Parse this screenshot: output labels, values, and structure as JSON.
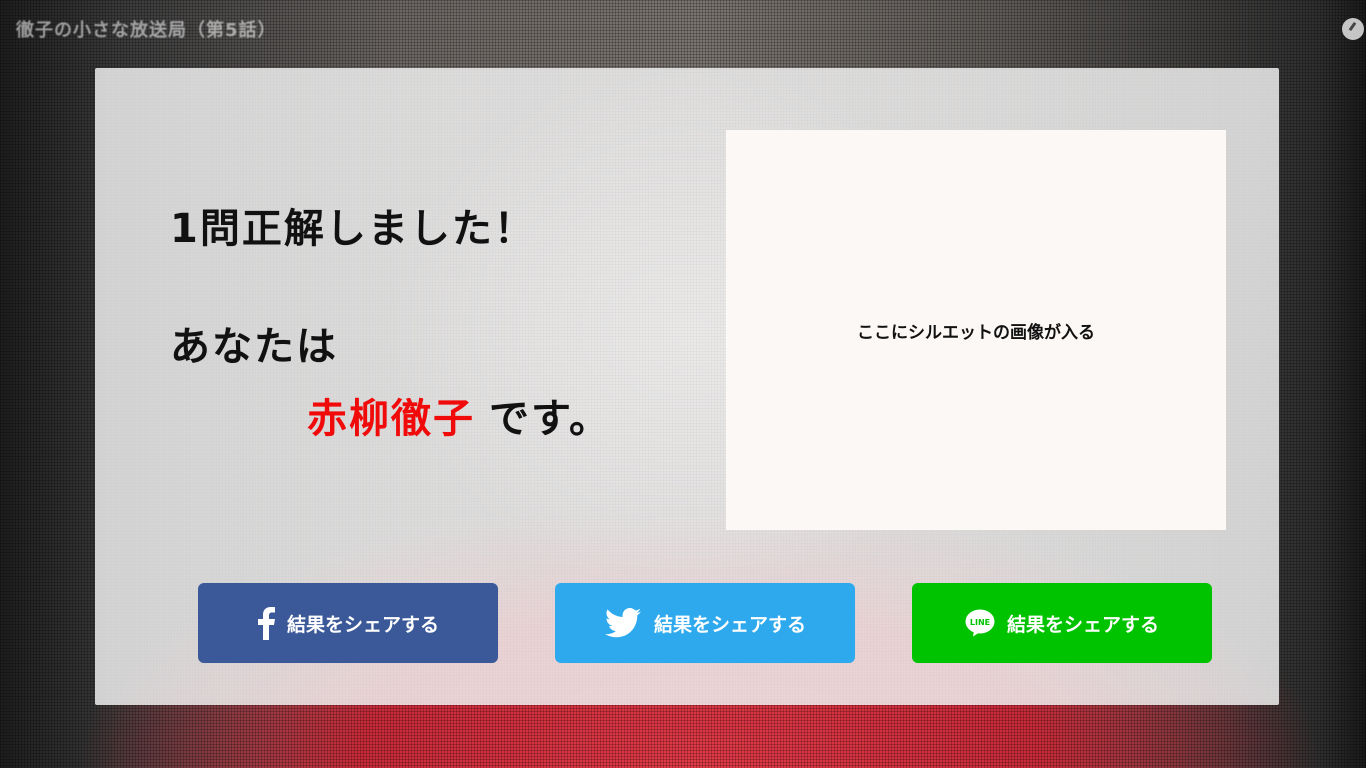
{
  "video": {
    "title": "徹子の小さな放送局（第5話）"
  },
  "result": {
    "heading": "1問正解しました！",
    "you_are": "あなたは",
    "name": "赤柳徹子",
    "suffix": "です。"
  },
  "silhouette": {
    "placeholder": "ここにシルエットの画像が入る"
  },
  "share": {
    "facebook": {
      "label": "結果をシェアする",
      "icon": "facebook-icon",
      "color": "#3b5998"
    },
    "twitter": {
      "label": "結果をシェアする",
      "icon": "twitter-bird-icon",
      "color": "#2ea9ee"
    },
    "line": {
      "label": "結果をシェアする",
      "icon": "line-icon",
      "color": "#00c300"
    }
  },
  "colors": {
    "name_accent": "#f00a0a"
  }
}
